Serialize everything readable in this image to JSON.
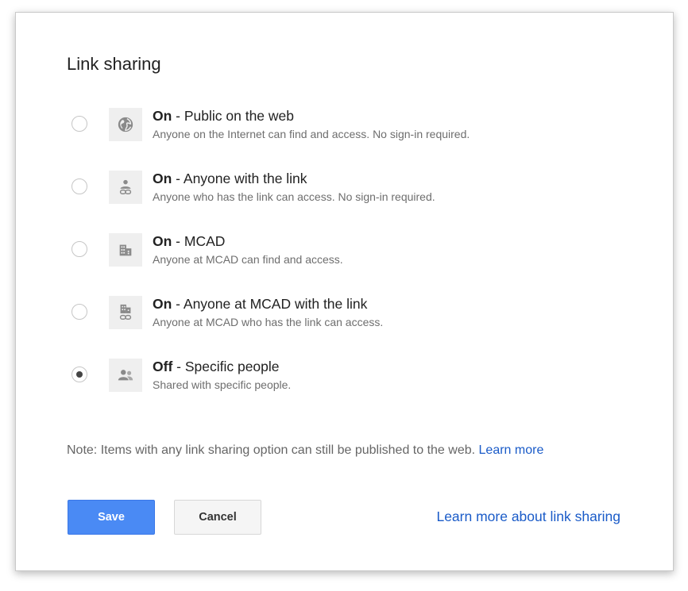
{
  "dialog": {
    "title": "Link sharing",
    "options": [
      {
        "state": "On",
        "title": " - Public on the web",
        "desc": "Anyone on the Internet can find and access. No sign-in required.",
        "icon": "globe-icon",
        "selected": false
      },
      {
        "state": "On",
        "title": " - Anyone with the link",
        "desc": "Anyone who has the link can access. No sign-in required.",
        "icon": "person-link-icon",
        "selected": false
      },
      {
        "state": "On",
        "title": " - MCAD",
        "desc": "Anyone at MCAD can find and access.",
        "icon": "building-icon",
        "selected": false
      },
      {
        "state": "On",
        "title": " - Anyone at MCAD with the link",
        "desc": "Anyone at MCAD who has the link can access.",
        "icon": "building-link-icon",
        "selected": false
      },
      {
        "state": "Off",
        "title": " - Specific people",
        "desc": "Shared with specific people.",
        "icon": "people-icon",
        "selected": true
      }
    ],
    "note": {
      "text": "Note: Items with any link sharing option can still be published to the web. ",
      "link": "Learn more"
    },
    "buttons": {
      "save": "Save",
      "cancel": "Cancel"
    },
    "learn_more_sharing": "Learn more about link sharing"
  },
  "colors": {
    "primary_button": "#4a8af4",
    "link": "#1a5bc8",
    "icon": "#8a8a8a"
  }
}
